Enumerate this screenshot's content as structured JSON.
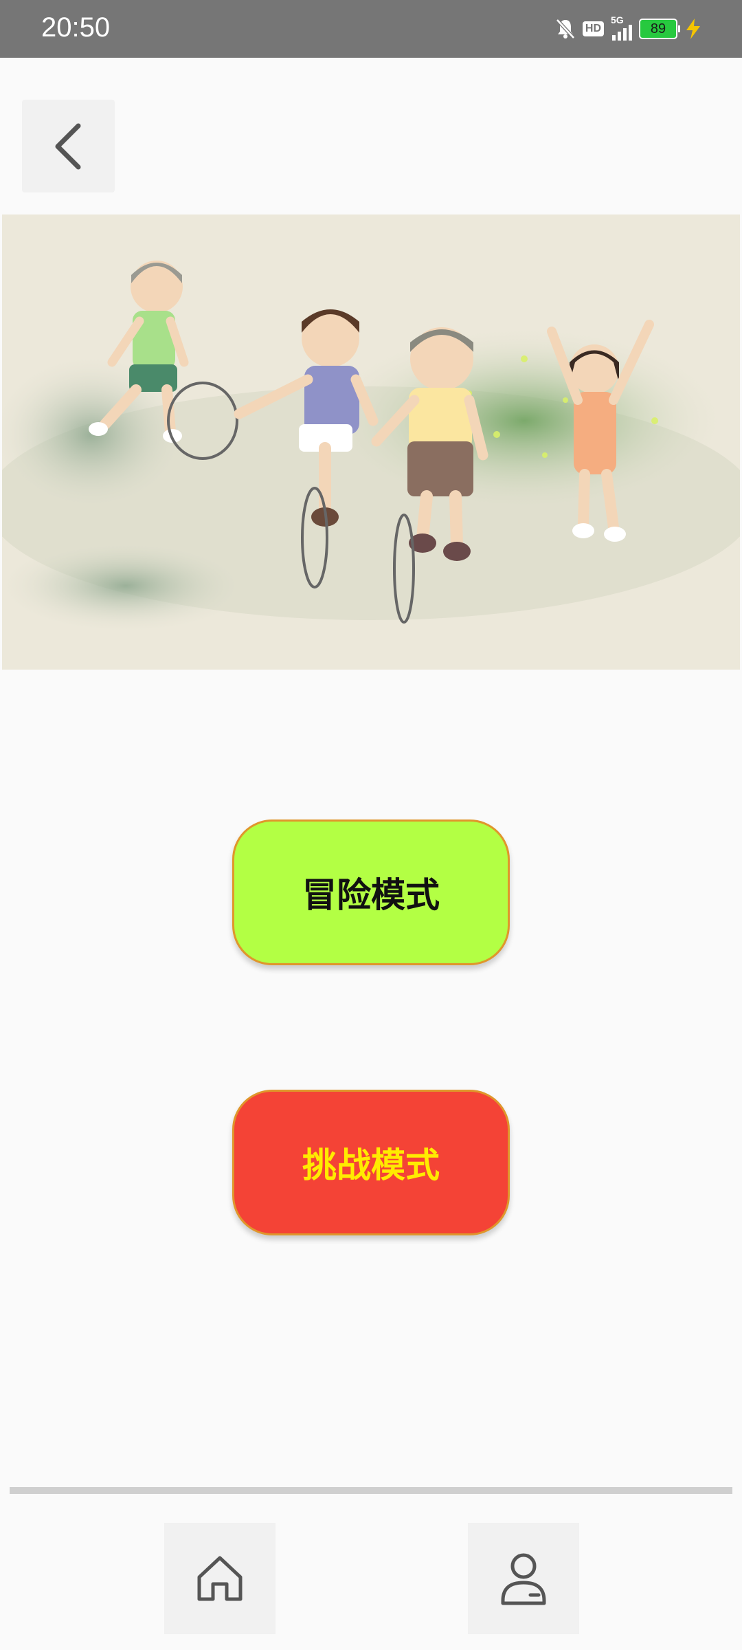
{
  "status_bar": {
    "time": "20:50",
    "hd_label": "HD",
    "network_label": "5G",
    "battery_level": "89",
    "icons": [
      "bell-muted-icon",
      "hd-icon",
      "signal-5g-icon",
      "battery-icon",
      "charging-bolt-icon"
    ],
    "background_color": "#767676"
  },
  "header": {
    "back_icon": "chevron-left-icon"
  },
  "hero_image": {
    "subject": "illustration of children rolling hoops"
  },
  "modes": {
    "adventure_label": "冒险模式",
    "adventure_color": "#b3ff44",
    "challenge_label": "挑战模式",
    "challenge_color": "#f44336",
    "challenge_text_color": "#ffeb00"
  },
  "bottom_nav": {
    "items": [
      {
        "icon": "home-icon"
      },
      {
        "icon": "profile-icon"
      }
    ]
  }
}
